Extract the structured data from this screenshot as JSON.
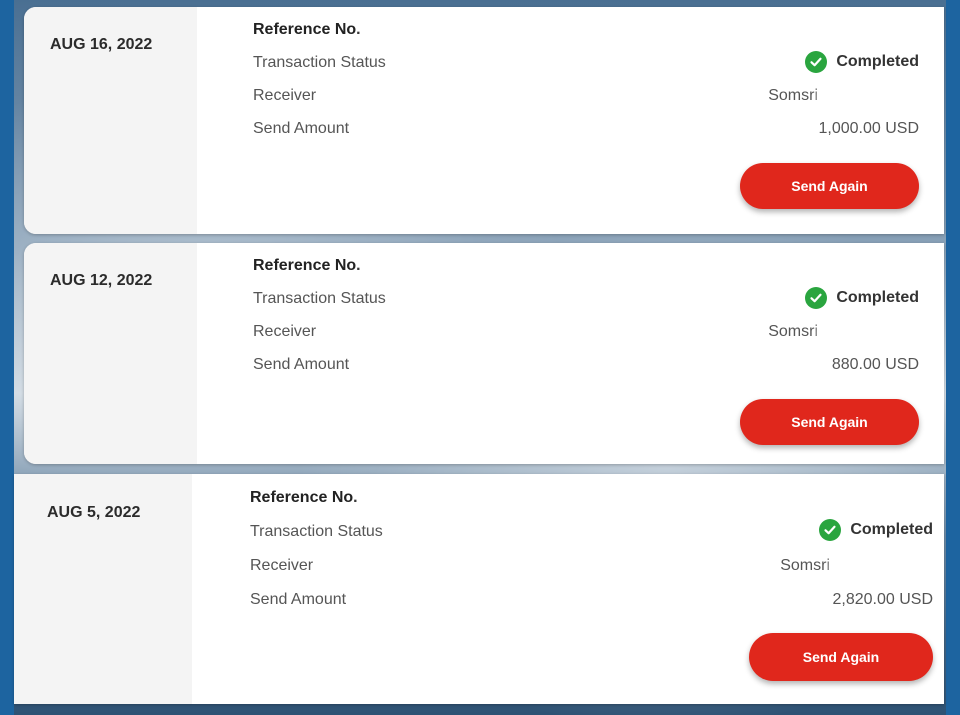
{
  "transactions": [
    {
      "date": "AUG 16, 2022",
      "reference_label": "Reference No.",
      "status_label": "Transaction Status",
      "status_value": "Completed",
      "receiver_label": "Receiver",
      "receiver_value": "Somsri",
      "amount_label": "Send Amount",
      "amount_value": "1,000.00 USD",
      "button_label": "Send Again"
    },
    {
      "date": "AUG 12, 2022",
      "reference_label": "Reference No.",
      "status_label": "Transaction Status",
      "status_value": "Completed",
      "receiver_label": "Receiver",
      "receiver_value": "Somsri",
      "amount_label": "Send Amount",
      "amount_value": "880.00 USD",
      "button_label": "Send Again"
    },
    {
      "date": "AUG 5, 2022",
      "reference_label": "Reference No.",
      "status_label": "Transaction Status",
      "status_value": "Completed",
      "receiver_label": "Receiver",
      "receiver_value": "Somsri",
      "amount_label": "Send Amount",
      "amount_value": "2,820.00 USD",
      "button_label": "Send Again"
    }
  ],
  "colors": {
    "accent": "#e0271c",
    "success": "#2aa53f",
    "frame": "#1d64a0"
  },
  "icons": {
    "status": "check-circle-icon"
  }
}
